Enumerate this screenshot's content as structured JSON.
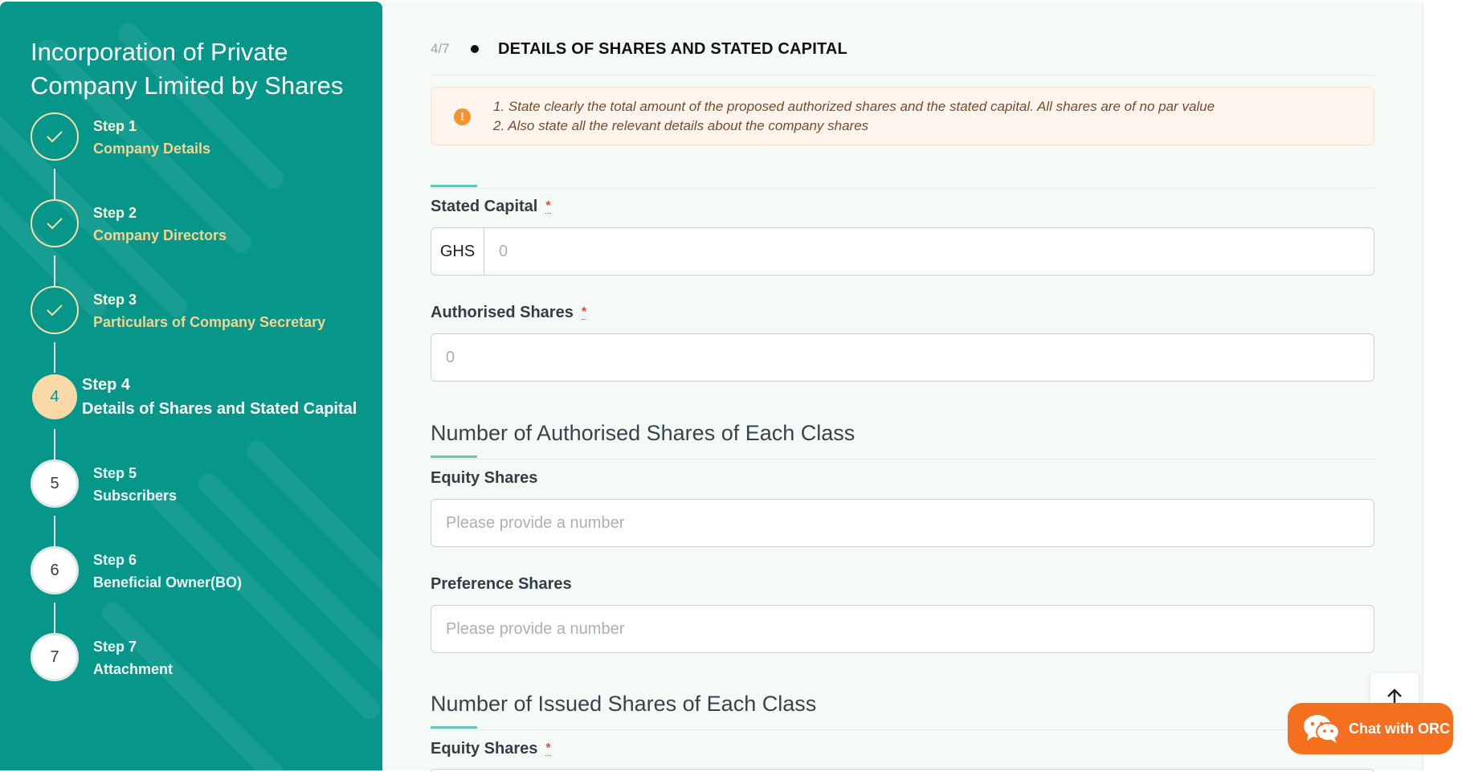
{
  "sidebar": {
    "title": "Incorporation of Private Company Limited by Shares",
    "steps": [
      {
        "label": "Step 1",
        "name": "Company Details",
        "state": "done"
      },
      {
        "label": "Step 2",
        "name": "Company Directors",
        "state": "done"
      },
      {
        "label": "Step 3",
        "name": "Particulars of Company Secretary",
        "state": "done"
      },
      {
        "label": "Step 4",
        "name": "Details of Shares and Stated Capital",
        "state": "current",
        "number": "4"
      },
      {
        "label": "Step 5",
        "name": "Subscribers",
        "state": "todo",
        "number": "5"
      },
      {
        "label": "Step 6",
        "name": "Beneficial Owner(BO)",
        "state": "todo",
        "number": "6"
      },
      {
        "label": "Step 7",
        "name": "Attachment",
        "state": "todo",
        "number": "7"
      }
    ]
  },
  "header": {
    "progress": "4/7",
    "title": "DETAILS OF SHARES AND STATED CAPITAL"
  },
  "alert": {
    "icon": "exclamation-icon",
    "line1": "1. State clearly the total amount of the proposed authorized shares and the stated capital. All shares are of no par value",
    "line2": "2. Also state all the relevant details about the company shares"
  },
  "form": {
    "stated_capital": {
      "label": "Stated Capital",
      "required_mark": "*",
      "currency": "GHS",
      "value": "0"
    },
    "authorised_shares": {
      "label": "Authorised Shares",
      "required_mark": "*",
      "value": "0"
    },
    "authorised_section_title": "Number of Authorised Shares of Each Class",
    "auth_equity": {
      "label": "Equity Shares",
      "placeholder": "Please provide a number"
    },
    "auth_preference": {
      "label": "Preference Shares",
      "placeholder": "Please provide a number"
    },
    "issued_section_title": "Number of Issued Shares of Each Class",
    "issued_equity": {
      "label": "Equity Shares",
      "required_mark": "*"
    }
  },
  "widgets": {
    "back_to_top_icon": "arrow-up-icon",
    "chat_label": "Chat with ORC",
    "chat_icon": "wechat-icon",
    "chat_color": "#f4701e"
  },
  "colors": {
    "sidebar_bg": "#07968a",
    "accent": "#65c5b6",
    "current_step": "#fbd9a6"
  }
}
